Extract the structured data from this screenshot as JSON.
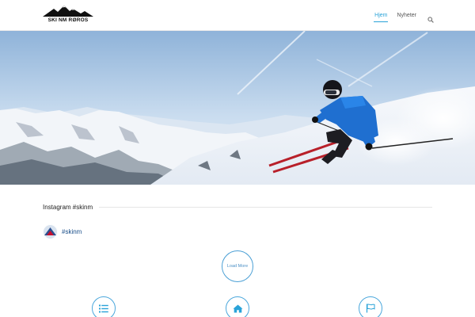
{
  "brand": {
    "logo_text": "SKI NM RØROS"
  },
  "nav": {
    "items": [
      {
        "label": "Hjem",
        "active": true
      },
      {
        "label": "Nyheter",
        "active": false
      }
    ],
    "search_icon": "search-icon"
  },
  "colors": {
    "accent": "#2aa3d8",
    "instagram_link": "#1a4f8a",
    "border": "#e9e9e9"
  },
  "hero": {
    "image": "skier-carving-on-snowy-mountain-slope"
  },
  "instagram": {
    "section_title": "Instagram #skinm",
    "profile_handle": "#skinm",
    "load_more_label": "Load More"
  },
  "features": [
    {
      "icon": "list-icon"
    },
    {
      "icon": "home-icon"
    },
    {
      "icon": "flag-icon"
    }
  ]
}
